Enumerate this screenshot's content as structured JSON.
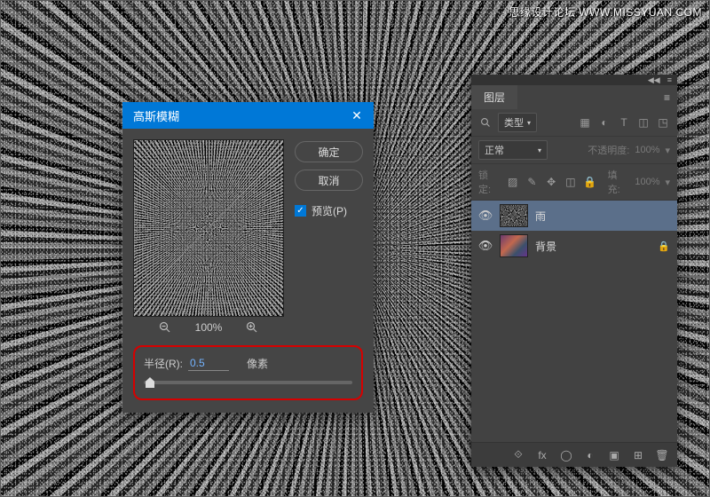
{
  "watermark": "思缘设计论坛  WWW.MISSYUAN.COM",
  "dialog": {
    "title": "高斯模糊",
    "ok": "确定",
    "cancel": "取消",
    "preview_label": "预览(P)",
    "zoom": "100%",
    "radius_label": "半径(R):",
    "radius_value": "0.5",
    "unit": "像素"
  },
  "layers": {
    "tab": "图层",
    "type_filter": "类型",
    "blend": "正常",
    "opacity_label": "不透明度:",
    "opacity_value": "100%",
    "lock_label": "锁定:",
    "fill_label": "填充:",
    "fill_value": "100%",
    "items": [
      {
        "name": "雨",
        "selected": true,
        "locked": false,
        "thumb": "noise"
      },
      {
        "name": "背景",
        "selected": false,
        "locked": true,
        "thumb": "img"
      }
    ]
  }
}
